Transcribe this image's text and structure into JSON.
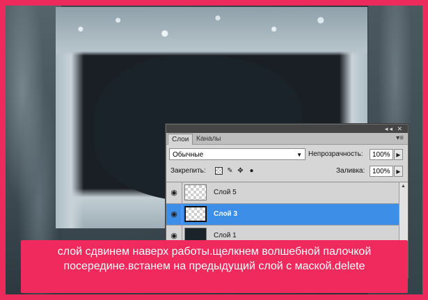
{
  "panel": {
    "tabs": [
      "Слои",
      "Каналы"
    ],
    "title_buttons": "◂◂ ✕",
    "menu_icon": "▾≡",
    "blend_mode": "Обычные",
    "opacity_label": "Непрозрачность:",
    "opacity_value": "100%",
    "lock_label": "Закрепить:",
    "fill_label": "Заливка:",
    "fill_value": "100%",
    "layers": [
      {
        "name": "Слой 5",
        "visible": true,
        "selected": false,
        "thumb": "transparent"
      },
      {
        "name": "Слой 3",
        "visible": true,
        "selected": true,
        "thumb": "transparent"
      },
      {
        "name": "Слой 1",
        "visible": true,
        "selected": false,
        "thumb": "dark"
      }
    ]
  },
  "banner": {
    "text": "слой сдвинем наверх работы.щелкнем волшебной палочкой посередине.встанем на предыдущий слой с маской.delete"
  },
  "colors": {
    "border": "#ec2a5c",
    "banner_bg": "#f02a5d",
    "selected_layer": "#3d8ee6"
  }
}
